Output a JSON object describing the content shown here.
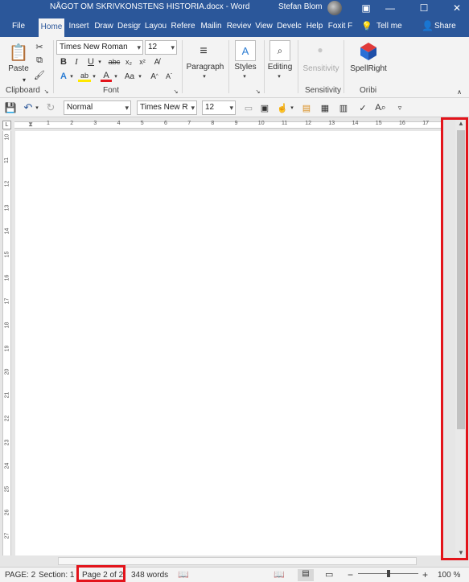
{
  "window": {
    "title": "NÅGOT OM SKRIVKONSTENS HISTORIA.docx  -  Word",
    "user": "Stefan Blom"
  },
  "tabs": [
    {
      "label": "File"
    },
    {
      "label": "Home"
    },
    {
      "label": "Insert"
    },
    {
      "label": "Draw"
    },
    {
      "label": "Desigr"
    },
    {
      "label": "Layou"
    },
    {
      "label": "Refere"
    },
    {
      "label": "Mailin"
    },
    {
      "label": "Reviev"
    },
    {
      "label": "View"
    },
    {
      "label": "Develc"
    },
    {
      "label": "Help"
    },
    {
      "label": "Foxit F"
    }
  ],
  "tellme": "Tell me",
  "share": "Share",
  "ribbon": {
    "clipboard": {
      "paste": "Paste",
      "label": "Clipboard"
    },
    "font": {
      "name": "Times New Roman",
      "size": "12",
      "label": "Font"
    },
    "paragraph": "Paragraph",
    "styles": "Styles",
    "editing": "Editing",
    "sensitivity": {
      "button": "Sensitivity",
      "label": "Sensitivity"
    },
    "spellright": {
      "button": "SpellRight",
      "label": "Oribi"
    }
  },
  "qat": {
    "style": "Normal",
    "font": "Times New R",
    "size": "12"
  },
  "ruler_numbers": [
    "1",
    "2",
    "3",
    "4",
    "5",
    "6",
    "7",
    "8",
    "9",
    "10",
    "11",
    "12",
    "13",
    "14",
    "15",
    "16",
    "17"
  ],
  "vruler_numbers": [
    "10",
    "11",
    "12",
    "13",
    "14",
    "15",
    "16",
    "17",
    "18",
    "19",
    "20",
    "21",
    "22",
    "23",
    "24",
    "25",
    "26",
    "27"
  ],
  "status": {
    "page": "PAGE: 2",
    "section": "Section: 1",
    "page_of": "Page 2 of 2",
    "words": "348 words",
    "zoom": "100 %"
  }
}
